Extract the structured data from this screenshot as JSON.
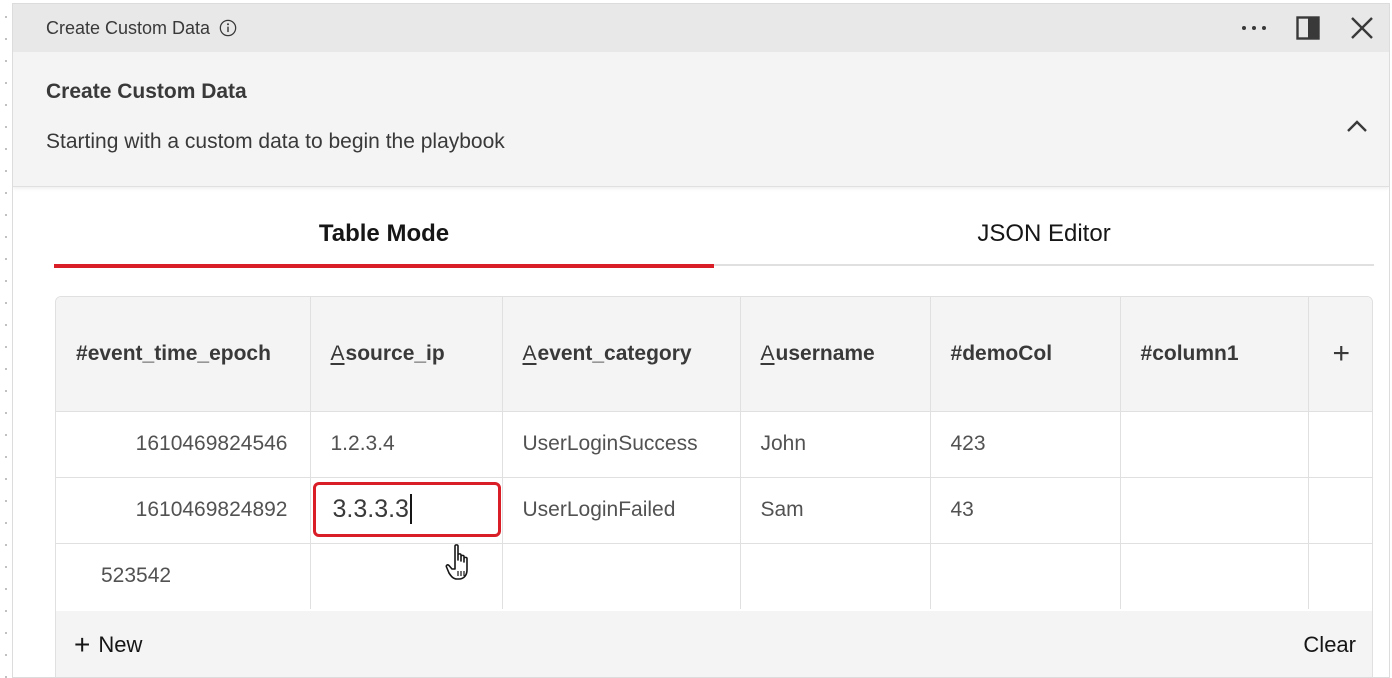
{
  "window": {
    "title": "Create Custom Data",
    "actions": [
      "more-options",
      "split-view",
      "close"
    ]
  },
  "summary": {
    "title": "Create Custom Data",
    "description": "Starting with a custom data to begin the playbook"
  },
  "tabs": [
    {
      "label": "Table Mode",
      "active": true
    },
    {
      "label": "JSON Editor",
      "active": false
    }
  ],
  "table": {
    "columns": [
      {
        "type_prefix": "#",
        "name": "event_time_epoch"
      },
      {
        "type_prefix": "A",
        "name": "source_ip"
      },
      {
        "type_prefix": "A",
        "name": "event_category"
      },
      {
        "type_prefix": "A",
        "name": "username"
      },
      {
        "type_prefix": "#",
        "name": "demoCol"
      },
      {
        "type_prefix": "#",
        "name": "column1"
      }
    ],
    "add_column_label": "+",
    "rows": [
      [
        "1610469824546",
        "1.2.3.4",
        "UserLoginSuccess",
        "John",
        "423",
        ""
      ],
      [
        "1610469824892",
        "3.3.3.3",
        "UserLoginFailed",
        "Sam",
        "43",
        ""
      ],
      [
        "523542",
        "",
        "",
        "",
        "",
        ""
      ]
    ],
    "editing_cell": {
      "row": 1,
      "col": 1,
      "value": "3.3.3.3"
    }
  },
  "footer": {
    "new_label": "New",
    "clear_label": "Clear"
  },
  "colors": {
    "accent": "#da1e28",
    "header_bg": "#e8e8e8",
    "panel_bg": "#f4f4f4"
  }
}
